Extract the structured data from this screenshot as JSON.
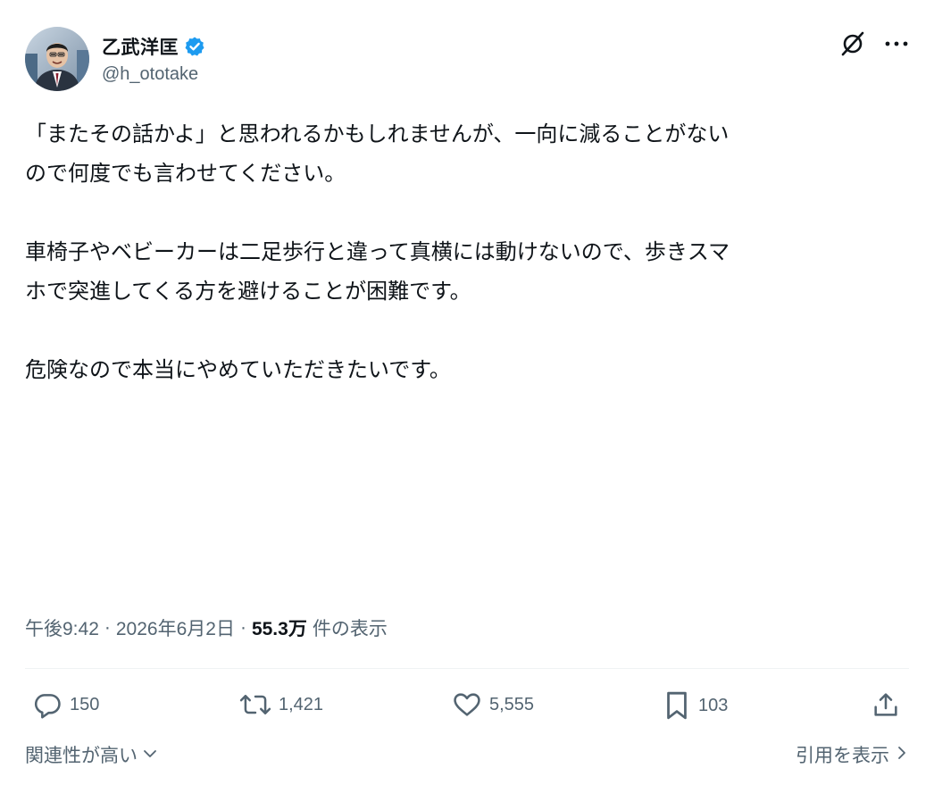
{
  "author": {
    "display_name": "乙武洋匡",
    "handle": "@h_ototake",
    "verified_color": "#1d9bf0",
    "avatar_icon": "profile-photo"
  },
  "tweet": {
    "paragraphs": [
      "「またその話かよ」と思われるかもしれませんが、一向に減ることがない\nので何度でも言わせてください。",
      "車椅子やベビーカーは二足歩行と違って真横には動けないので、歩きスマ\nホで突進してくる方を避けることが困難です。",
      "危険なので本当にやめていただきたいです。"
    ]
  },
  "meta": {
    "time": "午後9:42",
    "separator": "·",
    "date": "2026年6月2日",
    "views_count": "55.3万",
    "views_label": "件の表示"
  },
  "actions": {
    "replies": "150",
    "reposts": "1,421",
    "likes": "5,555",
    "bookmarks": "103"
  },
  "footer": {
    "sort_label": "関連性が高い",
    "quotes_label": "引用を表示"
  },
  "colors": {
    "text": "#0f1419",
    "secondary": "#536471",
    "accent": "#1d9bf0"
  }
}
